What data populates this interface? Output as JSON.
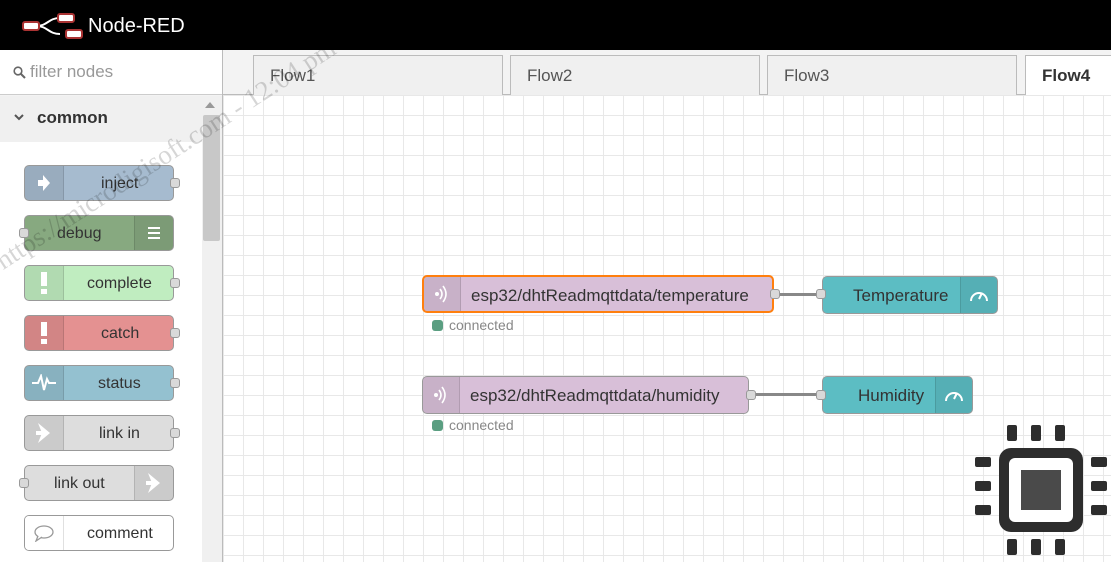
{
  "header": {
    "title": "Node-RED"
  },
  "palette": {
    "filter_placeholder": "filter nodes",
    "category": "common",
    "nodes": [
      {
        "label": "inject",
        "color": "#a6bbcf",
        "icon": "arrow-right-icon"
      },
      {
        "label": "debug",
        "color": "#87a980",
        "icon": "list-icon"
      },
      {
        "label": "complete",
        "color": "#c0edc0",
        "icon": "exclamation-icon"
      },
      {
        "label": "catch",
        "color": "#e49191",
        "icon": "exclamation-icon"
      },
      {
        "label": "status",
        "color": "#94c1d0",
        "icon": "pulse-icon"
      },
      {
        "label": "link in",
        "color": "#dddddd",
        "icon": "link-arrow-icon"
      },
      {
        "label": "link out",
        "color": "#dddddd",
        "icon": "link-arrow-icon"
      },
      {
        "label": "comment",
        "color": "#ffffff",
        "icon": "speech-bubble-icon"
      }
    ]
  },
  "tabs": [
    {
      "label": "Flow1",
      "active": false
    },
    {
      "label": "Flow2",
      "active": false
    },
    {
      "label": "Flow3",
      "active": false
    },
    {
      "label": "Flow4",
      "active": true
    }
  ],
  "flow": {
    "nodes": [
      {
        "label": "esp32/dhtReadmqttdata/temperature",
        "type": "mqtt in",
        "status": "connected",
        "selected": true
      },
      {
        "label": "Temperature",
        "type": "gauge"
      },
      {
        "label": "esp32/dhtReadmqttdata/humidity",
        "type": "mqtt in",
        "status": "connected",
        "selected": false
      },
      {
        "label": "Humidity",
        "type": "gauge"
      }
    ]
  },
  "watermark": "https://microdigisoft.com - 12:04 pm",
  "colors": {
    "mqtt": "#d8bfd8",
    "gauge": "#5cbdc3",
    "selection": "#ff7f0e",
    "status_connected": "#5a9e81"
  }
}
